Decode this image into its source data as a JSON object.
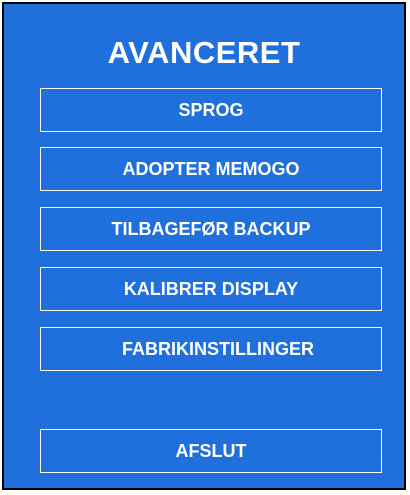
{
  "screen": {
    "title": "AVANCERET",
    "background_color": "#1f6fdc",
    "text_color": "#ffffff"
  },
  "menu": {
    "items": [
      {
        "label": "SPROG"
      },
      {
        "label": "ADOPTER MEMOGO"
      },
      {
        "label": "TILBAGEFØR BACKUP"
      },
      {
        "label": "KALIBRER DISPLAY"
      },
      {
        "label": "FABRIKINSTILLINGER"
      }
    ],
    "exit_label": "AFSLUT"
  }
}
